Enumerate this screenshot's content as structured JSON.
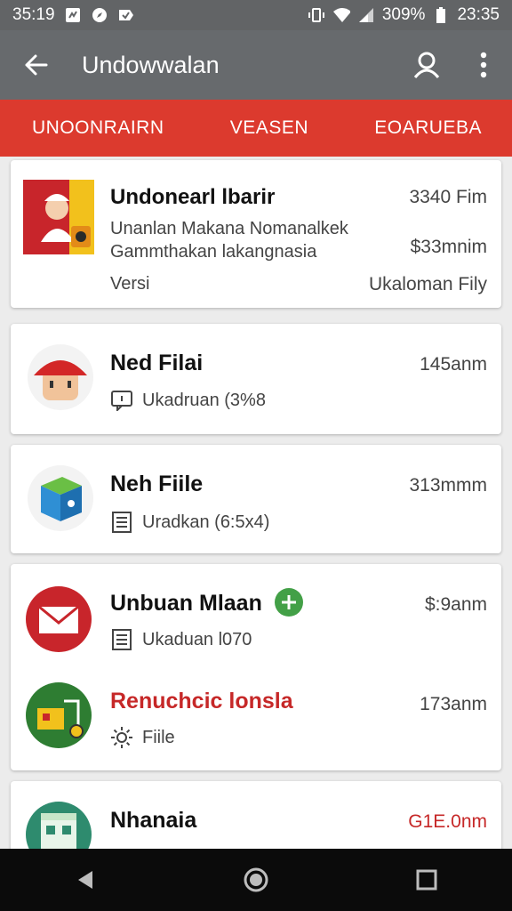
{
  "status_bar": {
    "time": "35:19",
    "battery": "309%",
    "clock": "23:35"
  },
  "app_bar": {
    "title": "Undowwalan"
  },
  "tabs": [
    "UNOONRAIRN",
    "VEASEN",
    "EOARUEBA"
  ],
  "items": [
    {
      "title": "Undonearl lbarir",
      "meta": "3340 Fim",
      "desc_line1": "Unanlan Makana Nomanalkek",
      "desc_line2": "Gammthakan lakangnasia",
      "meta2": "$33mnim",
      "version": "Versi",
      "action": "Ukaloman Fily"
    },
    {
      "title": "Ned Filai",
      "meta": "145anm",
      "sub": "Ukadruan (3%8"
    },
    {
      "title": "Neh Fiile",
      "meta": "313mmm",
      "sub": "Uradkan (6:5x4)"
    },
    {
      "title": "Unbuan Mlaan",
      "meta": "$:9anm",
      "sub": "Ukaduan l070"
    },
    {
      "title": "Renuchcic lonsla",
      "meta": "173anm",
      "sub": "Fiile"
    },
    {
      "title": "Nhanaia",
      "meta": "G1E.0nm"
    }
  ],
  "colors": {
    "accent": "#dc3a2e",
    "toolbar": "#676a6d",
    "status": "#626466",
    "danger_text": "#c62828",
    "badge": "#43a047"
  }
}
